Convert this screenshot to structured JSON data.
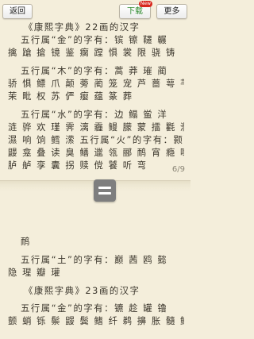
{
  "toolbar": {
    "back_label": "返回",
    "download_label": "下载",
    "new_badge": "New",
    "more_label": "更多"
  },
  "page_top": {
    "heading": "《康熙字典》22画的汉字",
    "lines": [
      "五行属“金”的字有：镔 镲 韆 輾",
      "擒 蹌 搶 镜 鉴 瘸 蹚 惧 裳 限 骁 铸",
      "五行属“木”的字有：蒿 莽 璀 蔺",
      "骄 惧 鳔 爪 颠 蒡 蔺 笼 宠 芦 蔷 萼 芊",
      "茉 毗 权 苏 俨 瘿 蕴 篆 葬",
      "五行属“水”的字有：边 鳎 鲎 洋",
      "涟 骅 欢 瑾 霁 漓 霾 鳗 朦 蒙 擂 氍 濮",
      "濕 响 饷 鳕 潆 五行属“火”的字有：颢",
      "鼹 龛 叠 读 臭 鳝 邋 瓴 郦 鸸 宵 瘾 嚷",
      "胪 舻 孪 囊 拐 赎 傥 饕 听 弯"
    ],
    "page_number": "6/9"
  },
  "page_bottom": {
    "lines": [
      "鸸",
      "五行属“土”的字有：巅 茜 鸥 懿",
      "隐 瑆 瓣 瓘",
      "《康熙字典》23画的汉字",
      "五行属“金”的字有：镳 趁 罐 镥",
      "颤 蛸 铄 鬃 鼹 鬓 鳍 纤 鹈 擤 胀 髓 鲟"
    ]
  },
  "handle": {
    "icon": "drag-handle-icon"
  }
}
